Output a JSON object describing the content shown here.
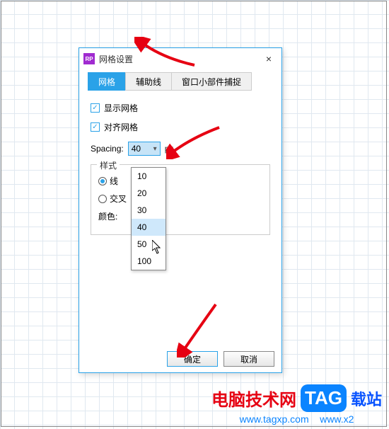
{
  "window": {
    "app_icon_text": "RP",
    "title": "网格设置",
    "close": "×"
  },
  "tabs": {
    "grid": "网格",
    "guides": "辅助线",
    "snap": "窗口小部件捕捉"
  },
  "options": {
    "show_grid": "显示网格",
    "align_grid": "对齐网格"
  },
  "spacing": {
    "label": "Spacing:",
    "value": "40",
    "unit": "px",
    "options": [
      "10",
      "20",
      "30",
      "40",
      "50",
      "100"
    ],
    "highlighted": "40"
  },
  "style": {
    "legend": "样式",
    "line": "线",
    "cross": "交叉",
    "color_label": "颜色:"
  },
  "buttons": {
    "ok": "确定",
    "cancel": "取消"
  },
  "watermark": {
    "brand": "电脑技术网",
    "tag": "TAG",
    "suffix": "载站",
    "url": "www.tagxp.com",
    "url2": "www.x2"
  }
}
